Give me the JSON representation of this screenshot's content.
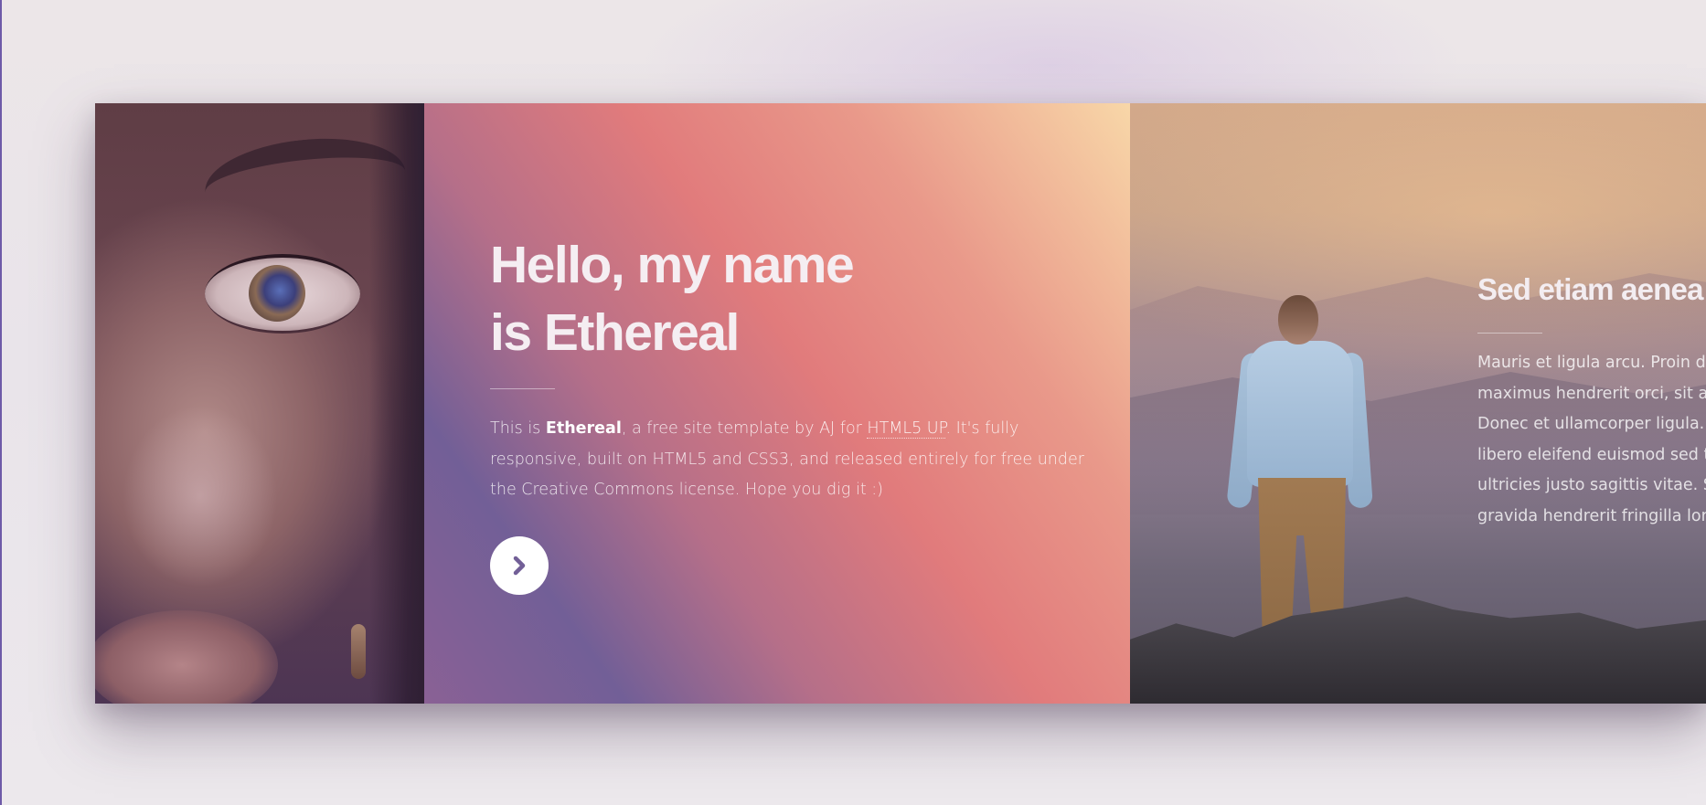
{
  "intro": {
    "title_line1": "Hello, my name",
    "title_line2": "is Ethereal",
    "text_prefix": "This is ",
    "text_brand": "Ethereal",
    "text_mid": ", a free site template by AJ for ",
    "text_link": "HTML5 UP",
    "text_suffix": ". It's fully responsive, built on HTML5 and CSS3, and released entirely for free under the Creative Commons license. Hope you dig it :)",
    "next_icon": "chevron-right-icon"
  },
  "feature": {
    "title": "Sed etiam aenea",
    "lines": [
      "Mauris et ligula arcu. Proin dap",
      "maximus hendrerit orci, sit am",
      "Donec et ullamcorper ligula. Su",
      "libero eleifend euismod sed tri",
      "ultricies justo sagittis vitae. Sed",
      "gravida hendrerit fringilla lorem"
    ]
  },
  "colors": {
    "gradient_warm": "#f8d7a8",
    "gradient_coral": "#e17b7c",
    "gradient_purple": "#725f97",
    "button_bg": "#ffffff",
    "icon_color": "#725f97"
  }
}
